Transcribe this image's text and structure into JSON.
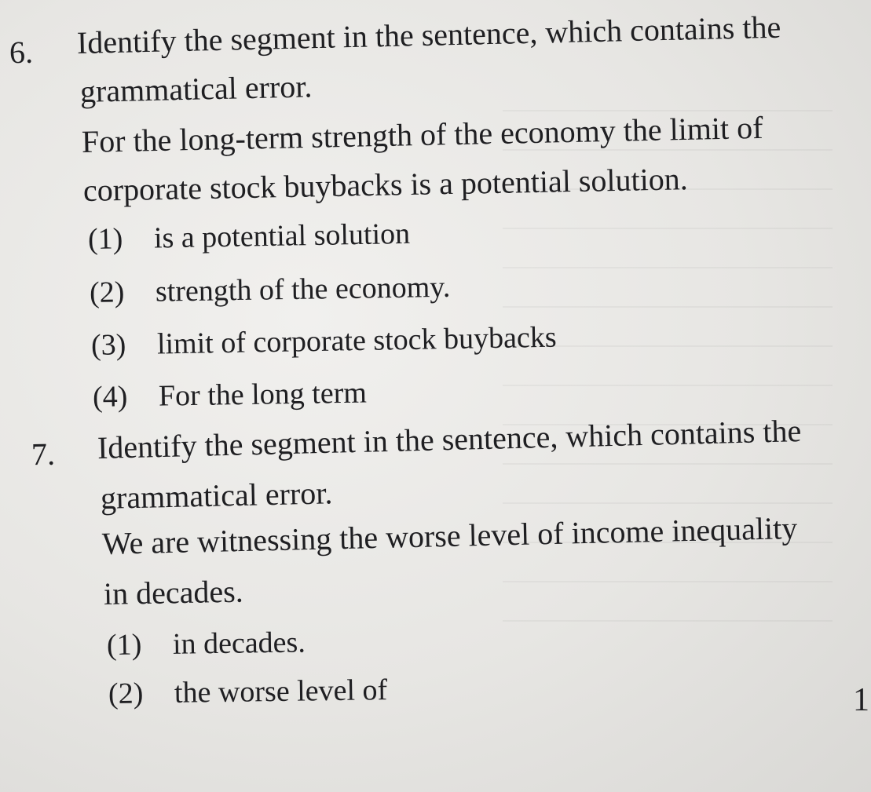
{
  "questions": [
    {
      "number": "6.",
      "prompt_line1": "Identify the segment in the sentence, which contains the",
      "prompt_line2": "grammatical error.",
      "sentence_line1": "For the long-term strength of the economy the limit of",
      "sentence_line2": "corporate stock buybacks is a potential solution.",
      "options": [
        {
          "num": "(1)",
          "text": "is a potential solution"
        },
        {
          "num": "(2)",
          "text": "strength of the economy."
        },
        {
          "num": "(3)",
          "text": "limit of corporate stock buybacks"
        },
        {
          "num": "(4)",
          "text": "For the long term"
        }
      ]
    },
    {
      "number": "7.",
      "prompt_line1": "Identify the segment in the sentence, which contains the",
      "prompt_line2": "grammatical error.",
      "sentence_line1": "We are witnessing the worse level of income inequality",
      "sentence_line2": "in decades.",
      "options": [
        {
          "num": "(1)",
          "text": "in decades."
        },
        {
          "num": "(2)",
          "text": "the worse level of"
        }
      ]
    }
  ],
  "page_number": "1"
}
